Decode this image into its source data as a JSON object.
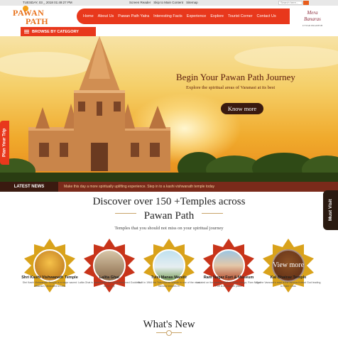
{
  "topbar": {
    "date": "TUESDAY, 03 _ 2018 01:49:27 PM",
    "links": [
      "Screen Reader",
      "Skip to Main Content",
      "Sitemap"
    ],
    "search_placeholder": "Search here..."
  },
  "header": {
    "logo_line1": "PAWAN",
    "logo_line2": "PATH",
    "nav": [
      "Home",
      "About Us",
      "Pawan Path Yatra",
      "Interesting Facts",
      "Experience",
      "Explore",
      "Tourist Corner",
      "Contact Us"
    ],
    "brand_script": "Mera Banaras",
    "brand_small": "UTTAR PRADESH"
  },
  "browse": {
    "label": "BROWSE BY CATEGORY"
  },
  "hero": {
    "title": "Begin Your Pawan Path Journey",
    "subtitle": "Explore the spiritual areas of Varanasi at its best",
    "button": "Know more",
    "plan_tab": "Plan Your Trip"
  },
  "news": {
    "label": "LATEST NEWS",
    "text": "Make this day a more spiritually uplifting experience. Step in to a kashi vishwanath temple today"
  },
  "must_visit": "Must Visit",
  "discover": {
    "title_line1": "Discover over 150 +Temples across",
    "title_line2": "Pawan Path",
    "subtitle": "Temples that you should not miss on your spiritual journey"
  },
  "temples": [
    {
      "name": "Shri Kashi Vishwanath Temple",
      "desc": "Shri Kashi Vishwanath Temple is a major sacred attraction, dedicated to Lord"
    },
    {
      "name": "Lalita Ghat",
      "desc": "Lalita Ghat is named after the most renowned Goddess of the city."
    },
    {
      "name": "Tulsi Manas Mandir",
      "desc": "Built in 1964 the Tulsi Manas Mandir is one of the most famous temples in"
    },
    {
      "name": "Ram Nagar Fort & Museum",
      "desc": "Located on the eastern bank of River Ganga, Ram Nagar Fort is a beautiful place"
    },
    {
      "name": "Kal Bhairav Temple",
      "desc": "On the Varanasi's road is the famous Kotwal God leading to Kabir Chau"
    }
  ],
  "view_more": "View more",
  "whats_new": "What's New",
  "colors": {
    "accent": "#e8381c",
    "dark": "#3a1a10",
    "logo": "#e8721c",
    "medal": "#d9a21b"
  }
}
